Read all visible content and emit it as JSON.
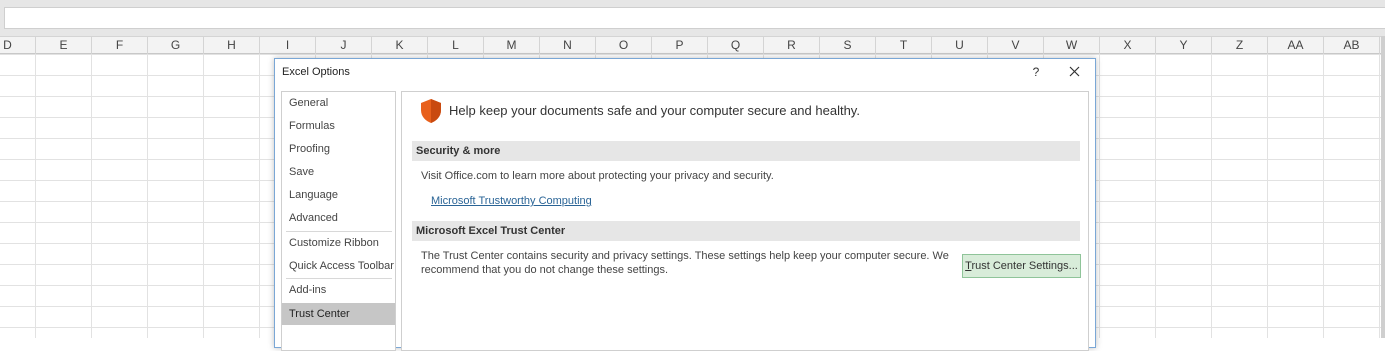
{
  "excel": {
    "columns": [
      "D",
      "E",
      "F",
      "G",
      "H",
      "I",
      "J",
      "K",
      "L",
      "M",
      "N",
      "O",
      "P",
      "Q",
      "R",
      "S",
      "T",
      "U",
      "V",
      "W",
      "X",
      "Y",
      "Z",
      "AA",
      "AB"
    ]
  },
  "dialog": {
    "title": "Excel Options",
    "help_label": "?",
    "close_label": "✕"
  },
  "nav": {
    "items": [
      {
        "label": "General"
      },
      {
        "label": "Formulas"
      },
      {
        "label": "Proofing"
      },
      {
        "label": "Save"
      },
      {
        "label": "Language"
      },
      {
        "label": "Advanced"
      },
      {
        "label": "Customize Ribbon"
      },
      {
        "label": "Quick Access Toolbar"
      },
      {
        "label": "Add-ins"
      },
      {
        "label": "Trust Center"
      }
    ],
    "selected": "Trust Center"
  },
  "content": {
    "intro": "Help keep your documents safe and your computer secure and healthy.",
    "security_section": {
      "heading": "Security & more",
      "text": "Visit Office.com to learn more about protecting your privacy and security.",
      "link": "Microsoft Trustworthy Computing"
    },
    "trust_section": {
      "heading": "Microsoft Excel Trust Center",
      "line1": "The Trust Center contains security and privacy settings. These settings help keep your computer secure. We",
      "line2": "recommend that you do not change these settings.",
      "button_first": "T",
      "button_rest": "rust Center Settings..."
    }
  },
  "colors": {
    "selected_nav": "#c6c6c6",
    "section_bg": "#e6e6e6",
    "button_bg": "#d8ecd9",
    "link": "#2a6496",
    "shield": "#e8601c"
  }
}
